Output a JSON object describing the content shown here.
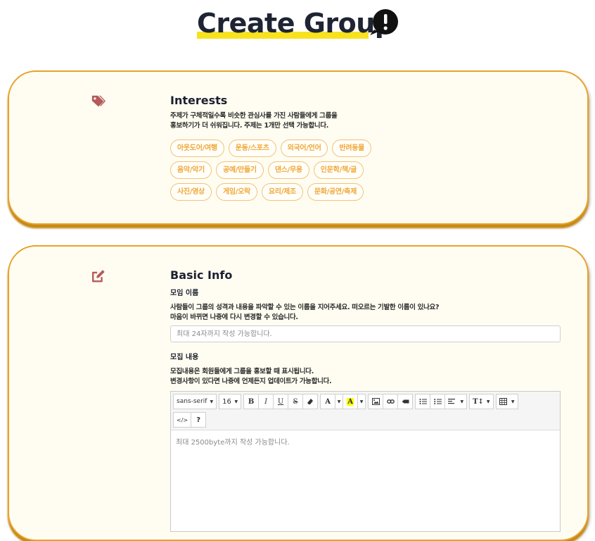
{
  "page": {
    "title": "Create Group"
  },
  "interests": {
    "title": "Interests",
    "desc_lines": [
      "주제가 구체적일수록 비슷한 관심사를 가진 사람들에게 그룹을",
      "홍보하기가 더 쉬워집니다. 주제는 1개만 선택 가능합니다."
    ],
    "chips": [
      "아웃도어/여행",
      "운동/스포츠",
      "외국어/언어",
      "반려동물",
      "음악/악기",
      "공예/만들기",
      "댄스/무용",
      "인문학/책/글",
      "사진/영상",
      "게임/오락",
      "요리/제조",
      "문화/공연/축제"
    ]
  },
  "basic_info": {
    "title": "Basic Info",
    "name_field": {
      "label": "모임 이름",
      "desc_lines": [
        "사람들이 그룹의 성격과 내용을 파악할 수 있는 이름을 지어주세요. 떠오르는 기발한 이름이 있나요?",
        "마음이 바뀌면 나중에 다시 변경할 수 있습니다."
      ],
      "placeholder": "최대 24자까지 작성 가능합니다."
    },
    "recruit_field": {
      "label": "모집 내용",
      "desc_lines": [
        "모집내용은 회원들에게 그룹을 홍보할 때 표시됩니다.",
        "변경사항이 있다면 나중에 언제든지 업데이트가 가능합니다."
      ],
      "editor_placeholder": "최대 2500byte까지 작성 가능합니다."
    }
  },
  "toolbar": {
    "font_family": "sans-serif",
    "font_size": "16",
    "bold": "B",
    "italic": "I",
    "underline": "U",
    "strike": "S",
    "fore_color": "A",
    "back_color": "A",
    "codeview": "</>",
    "help": "?"
  },
  "colors": {
    "accent": "#e8a22b",
    "card_bg": "#fffdf1",
    "chip_text": "#f0a736",
    "icon": "#b55a5a",
    "title_highlight": "#f7e21f"
  }
}
